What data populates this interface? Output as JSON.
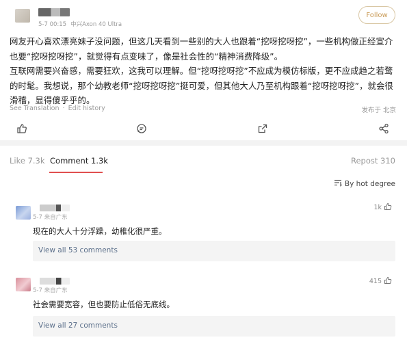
{
  "post": {
    "timestamp": "5-7 00:15",
    "device": "中兴Axon 40 Ultra",
    "follow_label": "Follow",
    "paragraph_1": "网友开心喜欢漂亮妹子没问题，但这几天看到一些别的大人也跟着“挖呀挖呀挖”，一些机构做正经宣介也要“挖呀挖呀挖”，就觉得有点变味了，像是社会性的“精神消费降级”。",
    "paragraph_2": "互联网需要兴奋感，需要狂欢，这我可以理解。但“挖呀挖呀挖”不应成为模仿标版，更不应成趋之若鹜的时髦。我想说，那个幼教老师“挖呀挖呀挖”挺可爱，但其他大人乃至机构跟着“挖呀挖呀挖”，就会很滑稽，显得傻乎乎的。",
    "see_translation": "See Translation",
    "separator": "·",
    "edit_history": "Edit history",
    "location": "发布于 北京"
  },
  "actions": [
    {
      "icon": "thumbs-up-icon"
    },
    {
      "icon": "comment-icon"
    },
    {
      "icon": "repost-icon"
    },
    {
      "icon": "share-icon"
    }
  ],
  "tabs": {
    "like": "Like 7.3k",
    "comment": "Comment 1.3k",
    "repost": "Repost 310"
  },
  "sort": {
    "label": "By hot degree",
    "icon": "sort-icon"
  },
  "comments": [
    {
      "meta": "5-7   来自广东",
      "likes": "1k",
      "text": "现在的大人十分浮躁，幼稚化很严重。",
      "view_all": "View all 53 comments"
    },
    {
      "meta": "5-7   来自广东",
      "likes": "415",
      "text": "社会需要宽容，但也要防止低俗无底线。",
      "view_all": "View all 27 comments"
    }
  ],
  "colors": {
    "accent": "#e05050",
    "follow": "#c99a55",
    "link": "#5b6f8a"
  }
}
